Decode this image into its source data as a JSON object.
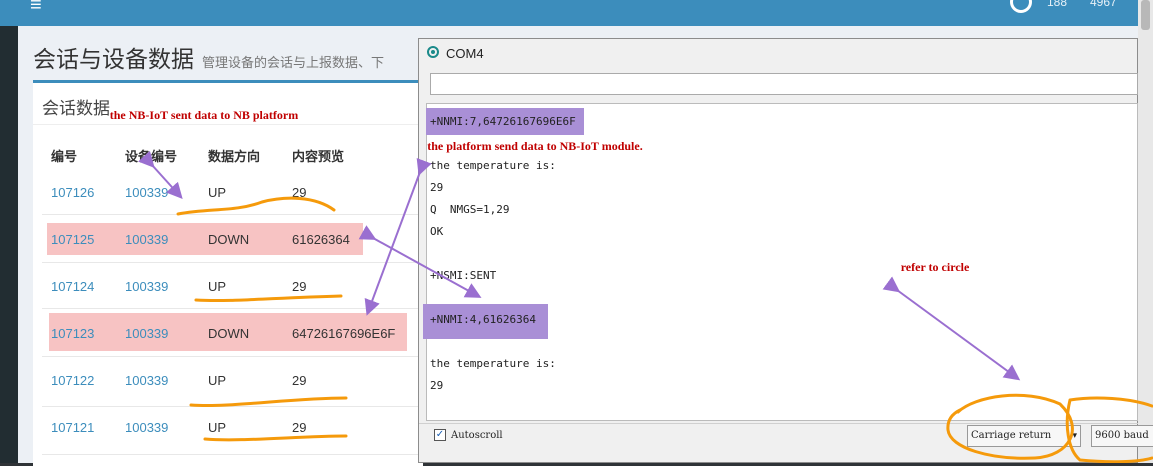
{
  "topbar": {
    "stat1": "188",
    "stat2": "4967"
  },
  "page": {
    "title": "会话与设备数据",
    "subtitle": "管理设备的会话与上报数据、下"
  },
  "box": {
    "title": "会话数据"
  },
  "table": {
    "headers": [
      "编号",
      "设备编号",
      "数据方向",
      "内容预览"
    ],
    "rows": [
      {
        "id": "107126",
        "device": "100339",
        "dir": "UP",
        "preview": "29"
      },
      {
        "id": "107125",
        "device": "100339",
        "dir": "DOWN",
        "preview": "61626364"
      },
      {
        "id": "107124",
        "device": "100339",
        "dir": "UP",
        "preview": "29"
      },
      {
        "id": "107123",
        "device": "100339",
        "dir": "DOWN",
        "preview": "64726167696E6F"
      },
      {
        "id": "107122",
        "device": "100339",
        "dir": "UP",
        "preview": "29"
      },
      {
        "id": "107121",
        "device": "100339",
        "dir": "UP",
        "preview": "29"
      }
    ]
  },
  "serial": {
    "title": "COM4",
    "lines": [
      "+NNMI:7,64726167696E6F",
      "the temperature is:",
      "29",
      "Q  NMGS=1,29",
      "OK",
      "+NSMI:SENT",
      "+NNMI:4,61626364",
      "the temperature is:",
      "29"
    ],
    "autoscroll_label": "Autoscroll",
    "line_ending": "Carriage return",
    "baud": "9600 baud"
  },
  "annotations": {
    "a1": "the NB-IoT sent data to NB platform",
    "a2": "the  platform send data to NB-IoT module.",
    "a3": "refer to circle"
  },
  "colors": {
    "accent": "#3c8dbc",
    "highlight_row": "#f7c3c3",
    "highlight_serial": "#a98fd6",
    "annotation_arrow": "#9a6fd0",
    "annotation_mark": "#f59a0b"
  }
}
